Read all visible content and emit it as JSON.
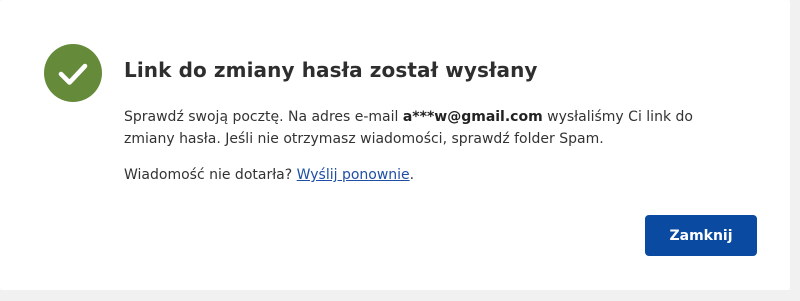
{
  "dialog": {
    "icon": "checkmark-circle-icon",
    "title": "Link do zmiany hasła został wysłany",
    "body_before_email": "Sprawdź swoją pocztę. Na adres e-mail ",
    "email": "a***w@gmail.com",
    "body_after_email": " wysłaliśmy Ci link do zmiany hasła. Jeśli nie otrzymasz wiadomości, sprawdź folder Spam.",
    "resend_prompt": "Wiadomość nie dotarła? ",
    "resend_link": "Wyślij ponownie",
    "resend_suffix": ".",
    "close_button": "Zamknij"
  },
  "colors": {
    "success_green": "#658b3a",
    "primary_blue": "#0a4ba1",
    "link_blue": "#1f4fa5",
    "page_background": "#f1f1f1"
  }
}
